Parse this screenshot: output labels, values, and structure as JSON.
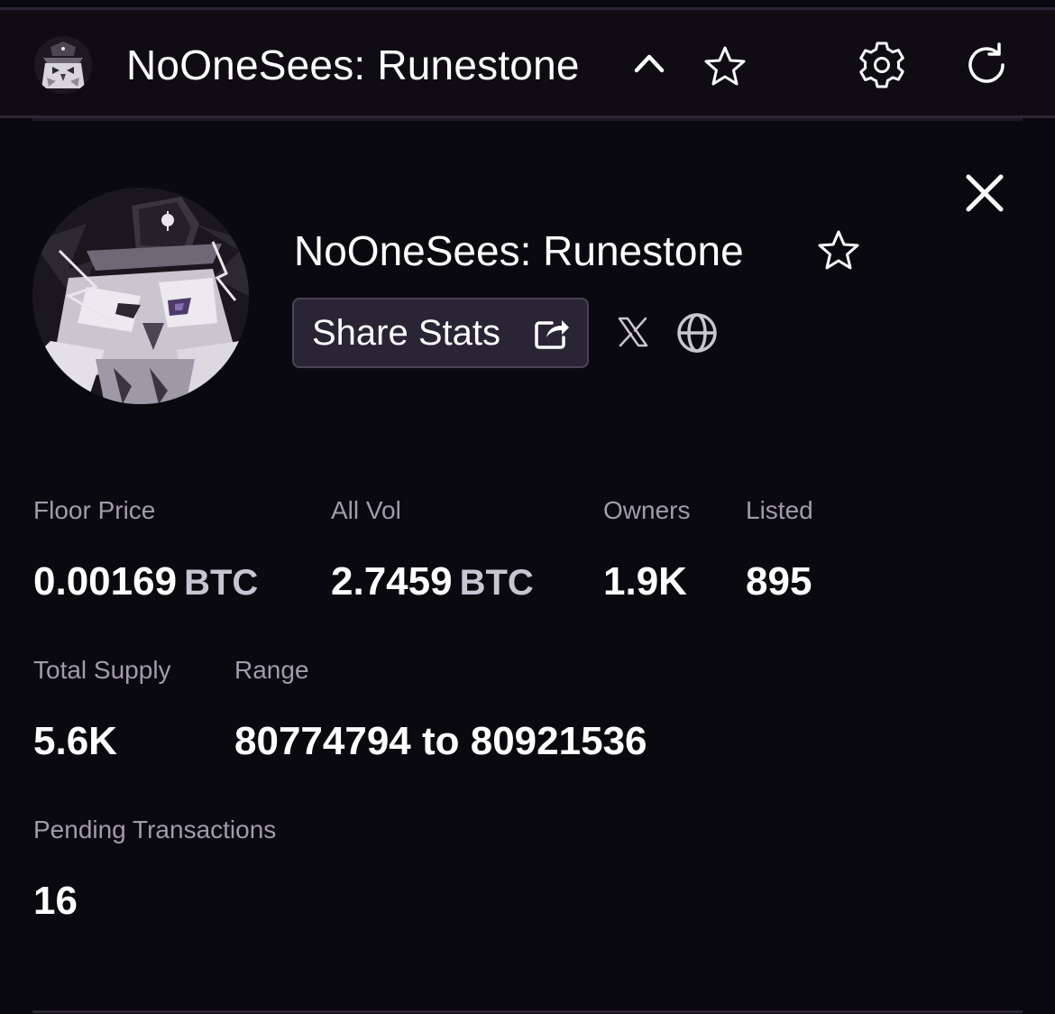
{
  "header": {
    "title": "NoOneSees: Runestone",
    "icons": [
      "owl-avatar-icon",
      "chevron-up-icon",
      "star-icon",
      "gear-icon",
      "refresh-icon"
    ]
  },
  "collection": {
    "name": "NoOneSees: Runestone",
    "share_label": "Share Stats",
    "icons": [
      "close-icon",
      "star-icon",
      "share-icon",
      "x-logo-icon",
      "globe-icon"
    ]
  },
  "stats": {
    "floor_price": {
      "label": "Floor Price",
      "value": "0.00169",
      "unit": "BTC"
    },
    "all_vol": {
      "label": "All Vol",
      "value": "2.7459",
      "unit": "BTC"
    },
    "owners": {
      "label": "Owners",
      "value": "1.9K"
    },
    "listed": {
      "label": "Listed",
      "value": "895"
    },
    "total_supply": {
      "label": "Total Supply",
      "value": "5.6K"
    },
    "range": {
      "label": "Range",
      "value": "80774794 to 80921536"
    },
    "pending": {
      "label": "Pending Transactions",
      "value": "16"
    }
  },
  "colors": {
    "background": "#0b0910",
    "header_bg": "#0f0c14",
    "muted_text": "#a19bab",
    "button_bg": "#2a2535",
    "button_border": "#4a4456"
  }
}
